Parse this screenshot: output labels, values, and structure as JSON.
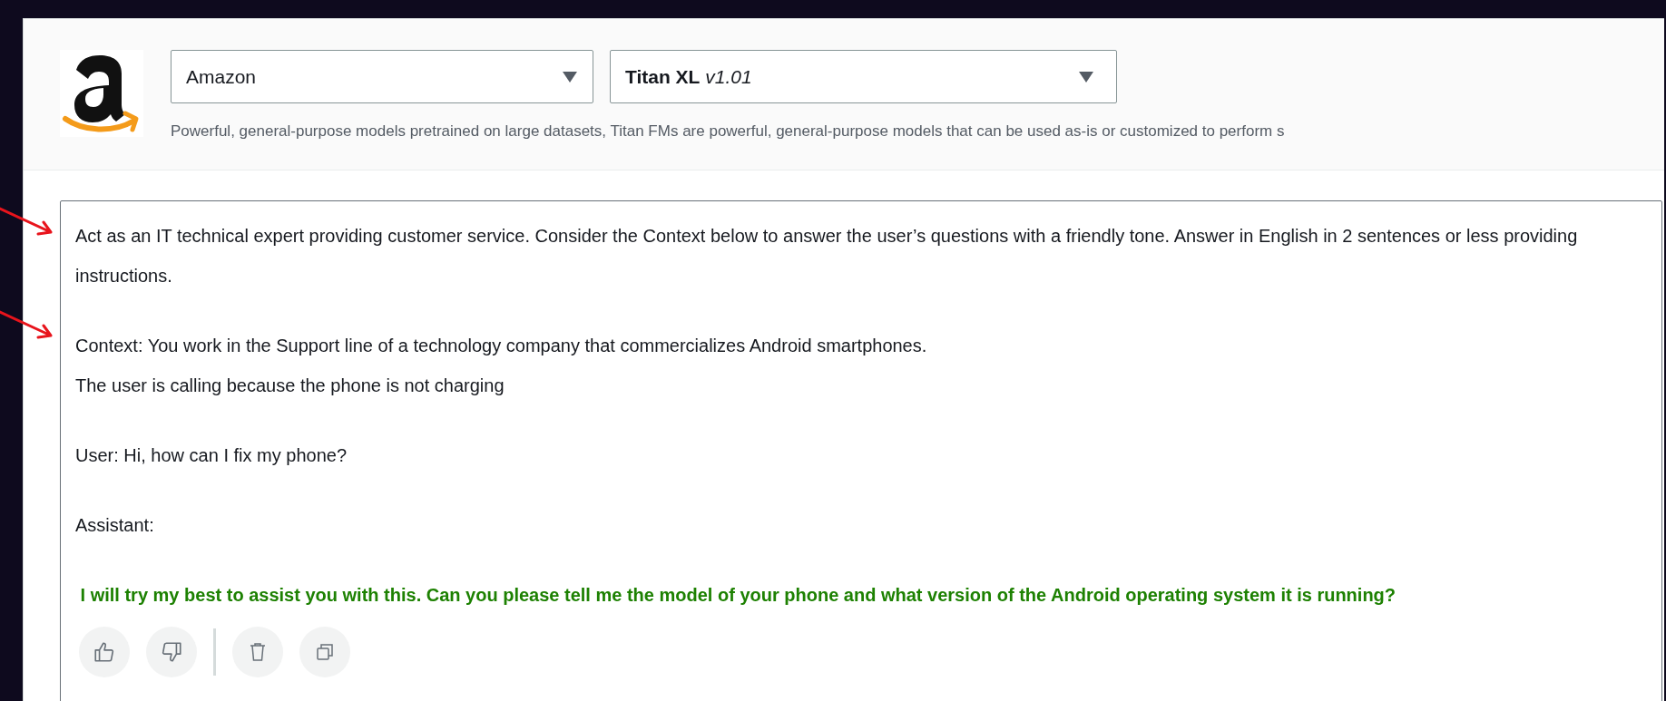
{
  "header": {
    "provider_select": {
      "value": "Amazon"
    },
    "model_select": {
      "name": "Titan XL",
      "version": "v1.01"
    },
    "description": "Powerful, general-purpose models pretrained on large datasets, Titan FMs are powerful, general-purpose models that can be used as-is or customized to perform s"
  },
  "prompt": {
    "paragraphs": [
      {
        "kind": "prompt",
        "lines": [
          "Act as an IT technical expert providing customer service. Consider the Context below to answer the user’s questions with a friendly tone. Answer in English in 2 sentences or less providing instructions."
        ]
      },
      {
        "kind": "prompt",
        "lines": [
          "Context: You work in the Support line of a technology company that commercializes Android smartphones.",
          "The user is calling because the phone is not charging"
        ]
      },
      {
        "kind": "prompt",
        "lines": [
          "User: Hi, how can I fix my phone?"
        ]
      },
      {
        "kind": "prompt",
        "lines": [
          "Assistant:"
        ]
      },
      {
        "kind": "response",
        "lines": [
          " I will try my best to assist you with this. Can you please tell me the model of your phone and what version of the Android operating system it is running?"
        ]
      }
    ]
  },
  "actions": [
    {
      "kind": "thumbs-up"
    },
    {
      "kind": "thumbs-down"
    },
    {
      "kind": "divider"
    },
    {
      "kind": "delete"
    },
    {
      "kind": "copy"
    }
  ]
}
